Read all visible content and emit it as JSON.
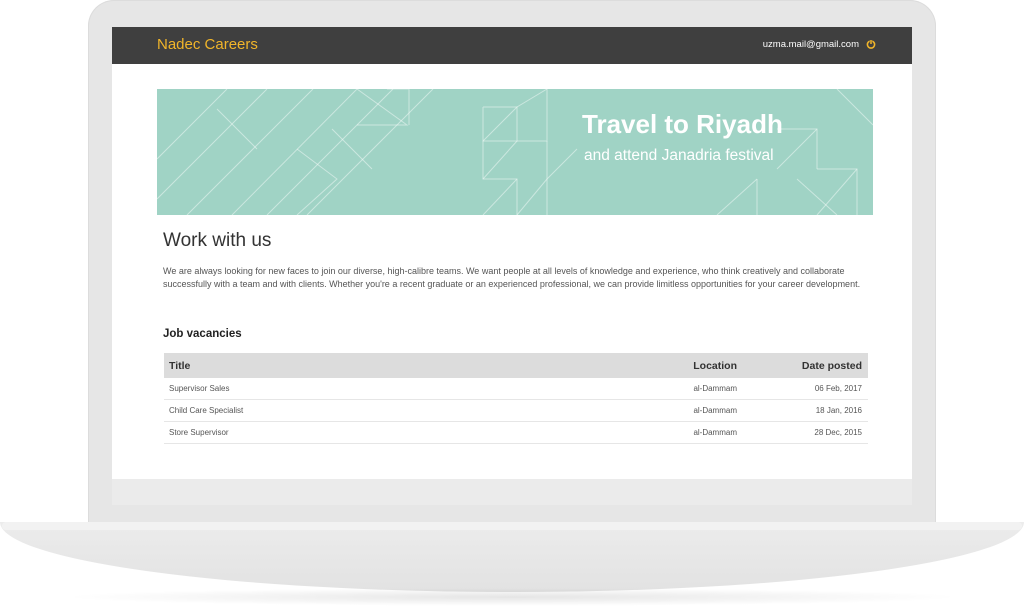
{
  "header": {
    "brand": "Nadec Careers",
    "user_email": "uzma.mail@gmail.com",
    "logout_icon": "power-icon",
    "brand_color": "#f1b52a",
    "bar_color": "#3f3f3f"
  },
  "banner": {
    "title": "Travel to Riyadh",
    "subtitle": "and attend Janadria festival",
    "color": "#a0d3c5"
  },
  "main": {
    "heading": "Work with us",
    "intro": "We are always looking for new faces to join our diverse, high-calibre teams. We want people at all levels of knowledge and experience, who think creatively and collaborate successfully with a team and with clients. Whether you're a recent graduate or an experienced professional, we can provide limitless opportunities for your career development."
  },
  "jobs": {
    "heading": "Job vacancies",
    "columns": {
      "title": "Title",
      "location": "Location",
      "date": "Date posted"
    },
    "rows": [
      {
        "title": "Supervisor Sales",
        "location": "al-Dammam",
        "date": "06 Feb, 2017"
      },
      {
        "title": "Child Care Specialist",
        "location": "al-Dammam",
        "date": "18 Jan, 2016"
      },
      {
        "title": "Store Supervisor",
        "location": "al-Dammam",
        "date": "28 Dec, 2015"
      }
    ]
  }
}
